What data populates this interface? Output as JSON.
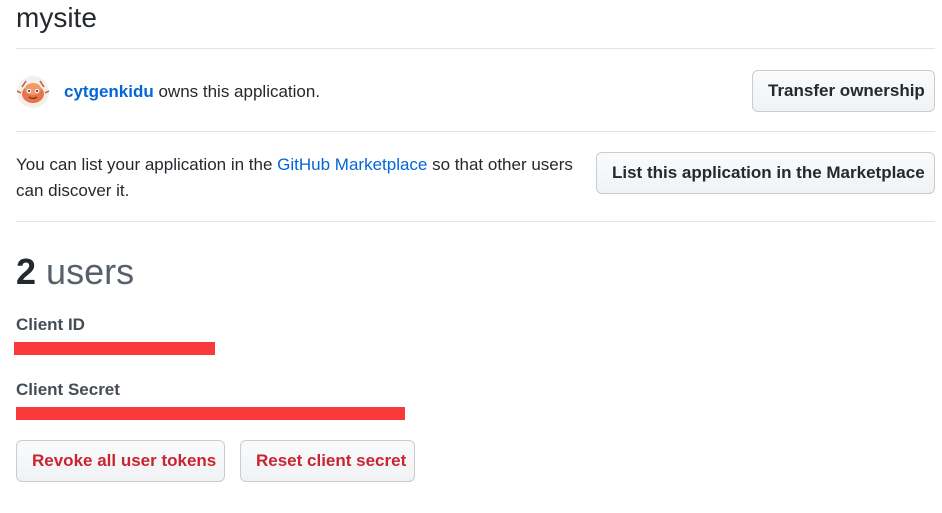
{
  "page": {
    "title": "mysite"
  },
  "owner": {
    "username": "cytgenkidu",
    "suffix": " owns this application.",
    "transfer_button": "Transfer ownership"
  },
  "marketplace": {
    "text_before": "You can list your application in the ",
    "link_text": "GitHub Marketplace",
    "text_after": " so that other users can discover it.",
    "button": "List this application in the Marketplace"
  },
  "users": {
    "count": "2",
    "label": "users"
  },
  "credentials": {
    "client_id_label": "Client ID",
    "client_secret_label": "Client Secret"
  },
  "actions": {
    "revoke_button": "Revoke all user tokens",
    "reset_button": "Reset client secret"
  },
  "colors": {
    "link": "#0366d6",
    "danger": "#cb2431",
    "redaction": "#fa3a3a"
  }
}
